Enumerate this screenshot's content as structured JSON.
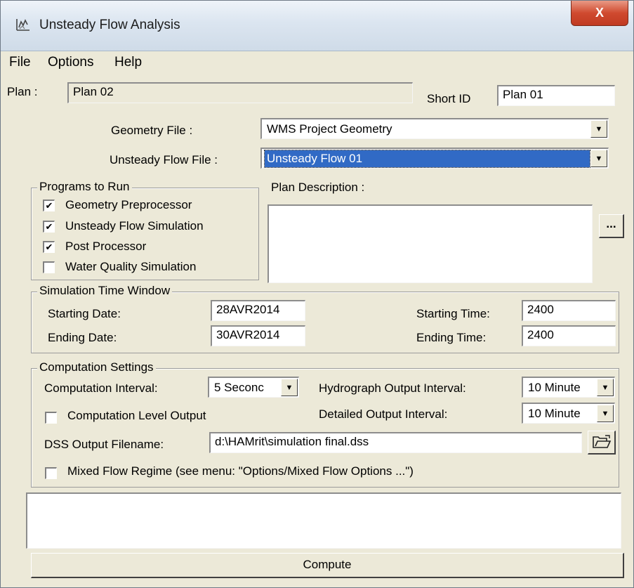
{
  "window": {
    "title": "Unsteady Flow Analysis",
    "close_label": "X"
  },
  "menu": {
    "file": "File",
    "options": "Options",
    "help": "Help"
  },
  "plan": {
    "label": "Plan :",
    "value": "Plan 02",
    "short_id_label": "Short ID",
    "short_id_value": "Plan 01"
  },
  "geometry": {
    "label": "Geometry File :",
    "value": "WMS Project Geometry"
  },
  "unsteady": {
    "label": "Unsteady Flow File :",
    "value": "Unsteady Flow 01"
  },
  "programs": {
    "title": "Programs to Run",
    "items": [
      {
        "label": "Geometry Preprocessor",
        "checked": true
      },
      {
        "label": "Unsteady Flow Simulation",
        "checked": true
      },
      {
        "label": "Post Processor",
        "checked": true
      },
      {
        "label": "Water Quality Simulation",
        "checked": false
      }
    ]
  },
  "plan_description": {
    "label": "Plan Description :",
    "value": "",
    "browse_label": "..."
  },
  "time_window": {
    "title": "Simulation Time Window",
    "start_date_label": "Starting Date:",
    "start_date": "28AVR2014",
    "start_time_label": "Starting Time:",
    "start_time": "2400",
    "end_date_label": "Ending Date:",
    "end_date": "30AVR2014",
    "end_time_label": "Ending Time:",
    "end_time": "2400"
  },
  "computation": {
    "title": "Computation Settings",
    "interval_label": "Computation Interval:",
    "interval_value": "5 Seconc",
    "hydrograph_label": "Hydrograph Output Interval:",
    "hydrograph_value": "10 Minute",
    "level_output_label": "Computation Level Output",
    "level_output_checked": false,
    "detailed_label": "Detailed Output Interval:",
    "detailed_value": "10 Minute",
    "dss_label": "DSS Output Filename:",
    "dss_value": "d:\\HAMrit\\simulation final.dss",
    "mixed_flow_label": "Mixed Flow Regime (see menu: \"Options/Mixed Flow Options ...\")",
    "mixed_flow_checked": false
  },
  "output_box": {
    "value": ""
  },
  "compute_label": "Compute",
  "check_glyph": "✔",
  "arrow_glyph": "▼"
}
